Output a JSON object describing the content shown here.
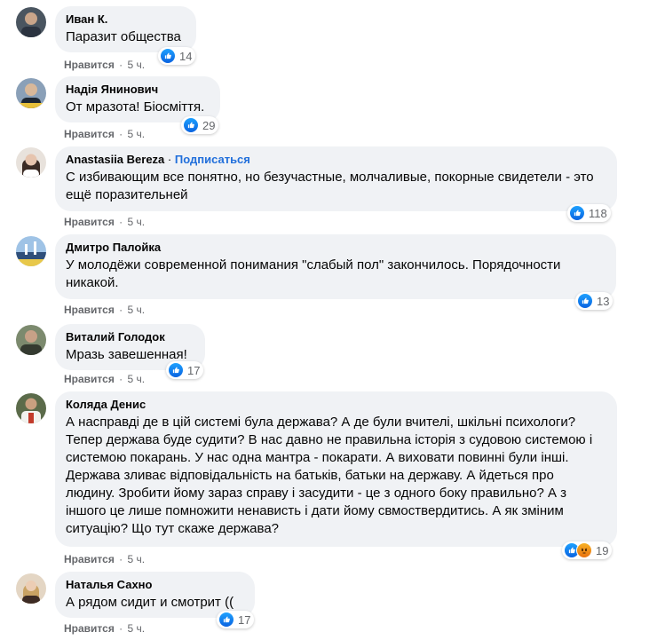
{
  "comments": [
    {
      "author": "Иван К.",
      "text": "Паразит общества",
      "reaction_count": "14",
      "like_label": "Нравится",
      "separator": "·",
      "time": "5 ч."
    },
    {
      "author": "Надія Янинович",
      "text": "От мразота! Біосміття.",
      "reaction_count": "29",
      "like_label": "Нравится",
      "separator": "·",
      "time": "5 ч."
    },
    {
      "author": "Anastasiia Bereza",
      "author_sep": "·",
      "follow_label": "Подписаться",
      "text": "С избивающим все понятно, но безучастные, молчаливые, покорные свидетели - это ещё поразительней",
      "reaction_count": "118",
      "like_label": "Нравится",
      "separator": "·",
      "time": "5 ч."
    },
    {
      "author": "Дмитро Палойка",
      "text": "У молодёжи современной понимания \"слабый пол\" закончилось. Порядочности никакой.",
      "reaction_count": "13",
      "like_label": "Нравится",
      "separator": "·",
      "time": "5 ч."
    },
    {
      "author": "Виталий Голодок",
      "text": "Мразь завешенная!",
      "reaction_count": "17",
      "like_label": "Нравится",
      "separator": "·",
      "time": "5 ч."
    },
    {
      "author": "Коляда Денис",
      "text": "А насправді де в цій системі була держава? А де були вчителі, шкільні психологи? Тепер держава буде судити? В нас давно не правильна історія з судовою системою і системою покарань. У нас одна мантра - покарати. А виховати повинні були інші. Держава зливає відповідальність на батьків, батьки на державу. А йдеться про людину. Зробити йому зараз справу і засудити - це з одного боку правильно? А з іншого це лише помножити ненависть і дати йому свмоствердитись. А як зміним ситуацію? Що тут скаже держава?",
      "reaction_count": "19",
      "like_label": "Нравится",
      "separator": "·",
      "time": "5 ч."
    },
    {
      "author": "Наталья Сахно",
      "text": "А рядом сидит и смотрит ((",
      "reaction_count": "17",
      "like_label": "Нравится",
      "separator": "·",
      "time": "5 ч."
    }
  ],
  "colors": {
    "bubble": "#f0f2f5",
    "text": "#050505",
    "meta": "#65676b",
    "like_icon": "#1877f2",
    "follow": "#216fdb"
  },
  "icons": {
    "like": "thumbs-up-icon",
    "angry": "angry-face-icon"
  }
}
